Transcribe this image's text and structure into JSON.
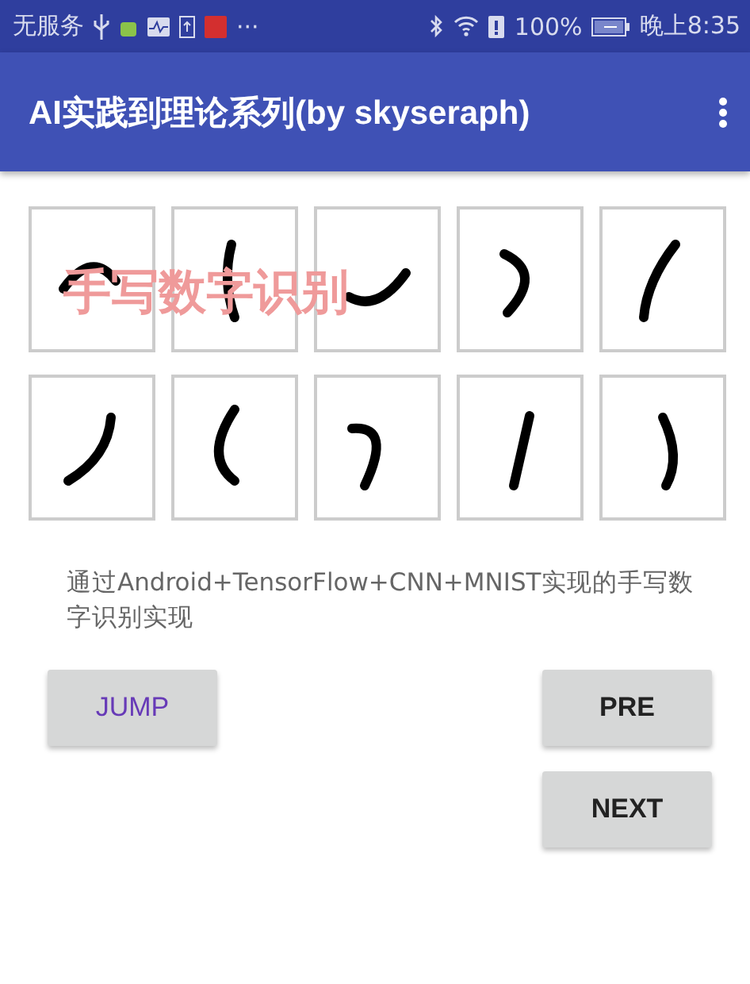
{
  "status_bar": {
    "carrier": "无服务",
    "more": "···",
    "battery_percent": "100%",
    "time": "晚上8:35"
  },
  "app_bar": {
    "title": "AI实践到理论系列(by skyseraph)"
  },
  "image": {
    "kind": "picture",
    "overlay": "手写数字识别"
  },
  "description": "通过Android+TensorFlow+CNN+MNIST实现的手写数字识别实现",
  "buttons": [
    {
      "label": "JUMP",
      "accent": true
    },
    {
      "label": "PRE",
      "accent": false
    },
    {
      "label": "NEXT",
      "accent": false
    }
  ]
}
